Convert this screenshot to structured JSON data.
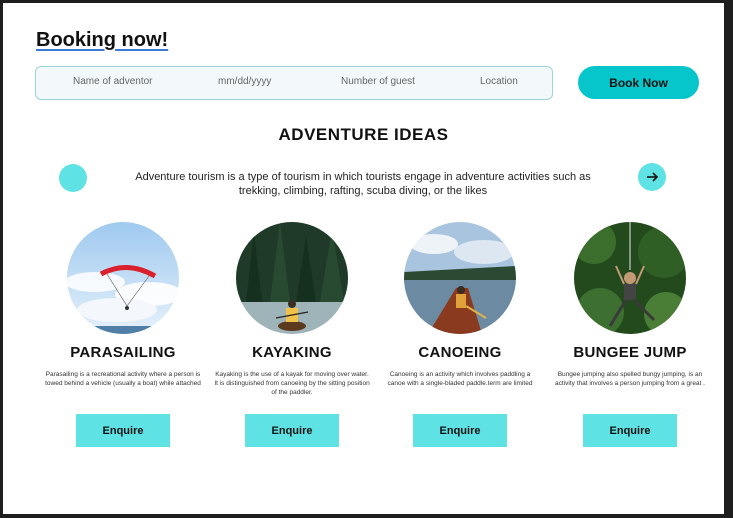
{
  "booking": {
    "title": "Booking now!",
    "search": {
      "name_placeholder": "Name of adventor",
      "date_placeholder": "mm/dd/yyyy",
      "guests_placeholder": "Number of guest",
      "location_placeholder": "Location"
    },
    "book_button": "Book Now"
  },
  "ideas": {
    "title": "ADVENTURE IDEAS",
    "description": "Adventure tourism is a type of tourism in which tourists engage in adventure activities such as trekking, climbing, rafting, scuba diving, or the likes",
    "next_icon": "arrow-right-icon"
  },
  "cards": [
    {
      "name": "PARASAILING",
      "text": "Parasailing is a recreational activity where a person is towed behind a vehicle (usually a boat) while attached",
      "button": "Enquire"
    },
    {
      "name": "KAYAKING",
      "text": "Kayaking is the use of a kayak for moving over water. It is distinguished from canoeing by the sitting position of the paddler.",
      "button": "Enquire"
    },
    {
      "name": "CANOEING",
      "text": "Canoeing is an activity which involves paddling a canoe with a single-bladed paddle.term are limited",
      "button": "Enquire"
    },
    {
      "name": "BUNGEE JUMP",
      "text": "Bungee jumping also spelled bungy jumping, is an activity that involves a person jumping from a great .",
      "button": "Enquire"
    }
  ],
  "colors": {
    "accent": "#06c6cb",
    "accent_light": "#5fe2e3",
    "underline": "#3a7bd5"
  }
}
